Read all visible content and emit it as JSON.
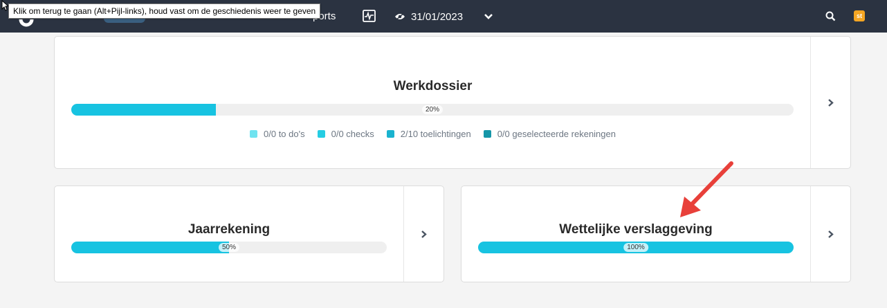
{
  "tooltip": {
    "text": "Klik om terug te gaan (Alt+Pijl-links), houd vast om de geschiedenis weer te geven"
  },
  "nav": {
    "reports_fragment": "ports",
    "date": "31/01/2023",
    "user_badge": "st",
    "icons": [
      "back-cursor-icon",
      "logo-icon",
      "pulse-chart-icon",
      "eye-icon",
      "chevron-down-icon",
      "search-icon"
    ]
  },
  "colors": {
    "nav_bg": "#2b3341",
    "progress_fill": "#17c3e1",
    "progress_track": "#efefef",
    "annotation_arrow": "#e8403a",
    "badge": "#f5a623"
  },
  "cards": {
    "werkdossier": {
      "title": "Werkdossier",
      "progress": 20,
      "progress_label": "20%",
      "legend": [
        {
          "label": "0/0 to do's",
          "color": "#6fe3f0"
        },
        {
          "label": "0/0 checks",
          "color": "#25cde3"
        },
        {
          "label": "2/10 toelichtingen",
          "color": "#1ab3cf"
        },
        {
          "label": "0/0 geselecteerde rekeningen",
          "color": "#1596a8"
        }
      ]
    },
    "jaarrekening": {
      "title": "Jaarrekening",
      "progress": 50,
      "progress_label": "50%"
    },
    "wettelijke": {
      "title": "Wettelijke verslaggeving",
      "progress": 100,
      "progress_label": "100%"
    }
  }
}
